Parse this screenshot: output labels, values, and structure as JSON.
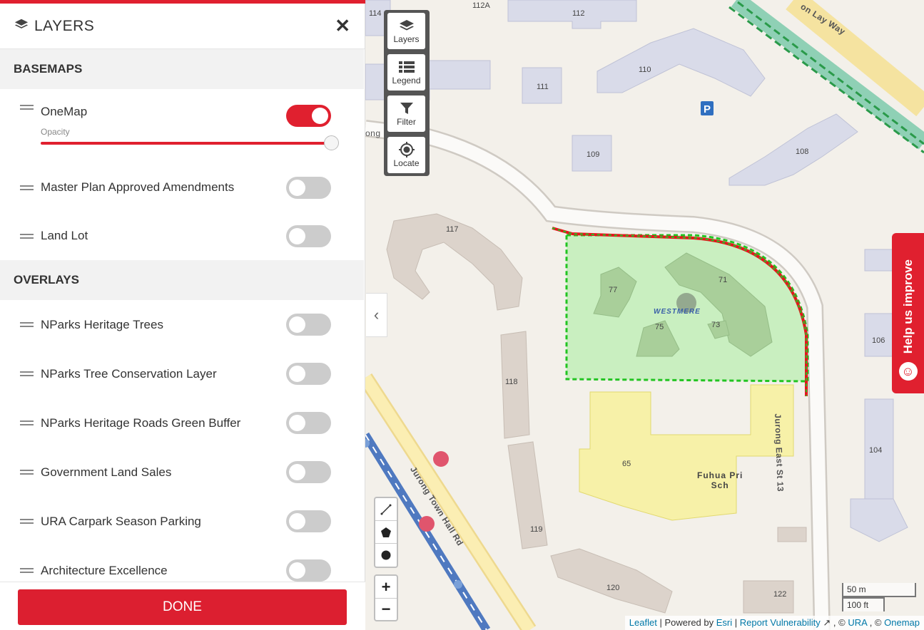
{
  "panel": {
    "title": "LAYERS",
    "basemaps_heading": "BASEMAPS",
    "overlays_heading": "OVERLAYS",
    "basemaps": [
      {
        "label": "OneMap",
        "enabled": true,
        "opacity_label": "Opacity",
        "opacity": 1.0
      },
      {
        "label": "Master Plan Approved Amendments",
        "enabled": false
      },
      {
        "label": "Land Lot",
        "enabled": false
      }
    ],
    "overlays": [
      {
        "label": "NParks Heritage Trees",
        "enabled": false
      },
      {
        "label": "NParks Tree Conservation Layer",
        "enabled": false
      },
      {
        "label": "NParks Heritage Roads Green Buffer",
        "enabled": false
      },
      {
        "label": "Government Land Sales",
        "enabled": false
      },
      {
        "label": "URA Carpark Season Parking",
        "enabled": false
      },
      {
        "label": "Architecture Excellence",
        "enabled": false
      }
    ],
    "done_label": "DONE"
  },
  "map_toolbar": {
    "layers": "Layers",
    "legend": "Legend",
    "filter": "Filter",
    "locate": "Locate"
  },
  "zoom": {
    "in": "+",
    "out": "−"
  },
  "scale": {
    "metric": "50 m",
    "imperial": "100 ft"
  },
  "attribution": {
    "leaflet": "Leaflet",
    "powered_by": "Powered by",
    "esri": "Esri",
    "report": "Report Vulnerability",
    "ura_prefix": ", ©",
    "ura": "URA",
    "onemap_prefix": ", ©",
    "onemap": "Onemap"
  },
  "help_tab": "Help us improve",
  "map_labels": {
    "b112a": "112A",
    "b112": "112",
    "b114": "114",
    "b110": "110",
    "b111": "111",
    "b109": "109",
    "b108": "108",
    "b117": "117",
    "b118": "118",
    "b119": "119",
    "b120": "120",
    "b122": "122",
    "b104": "104",
    "b106": "106",
    "b77": "77",
    "b71": "71",
    "b75": "75",
    "b73": "73",
    "b65": "65",
    "estate": "WESTMERE",
    "school": "Fuhua Pri\nSch",
    "road_jurong_east": "Jurong East St 13",
    "road_town_hall": "Jurong Town Hall Rd",
    "road_lay_way": "on Lay Way",
    "road_jurong_left": "ong"
  },
  "colors": {
    "accent": "#e0202f",
    "selection_fill": "#c9efc0",
    "selection_stroke": "#22c422",
    "school_fill": "#f7f1a8",
    "building_fill": "#d9dbe9",
    "hdb_beige": "#dcd3cb"
  }
}
